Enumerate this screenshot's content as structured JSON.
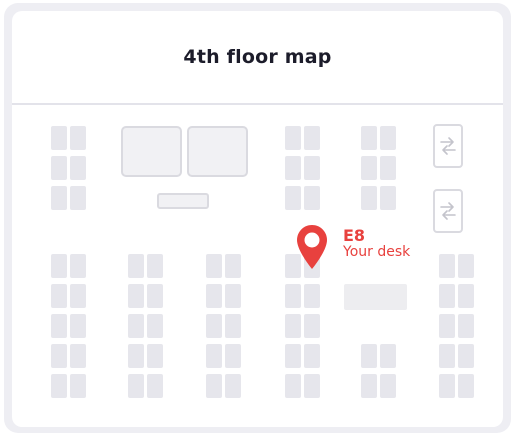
{
  "map": {
    "title": "4th floor map",
    "accent_color": "#e8413e",
    "icons": {
      "pin": "location-pin-icon",
      "lift": "swap-arrows-icon"
    }
  },
  "your_desk": {
    "code": "E8",
    "label": "Your desk"
  }
}
